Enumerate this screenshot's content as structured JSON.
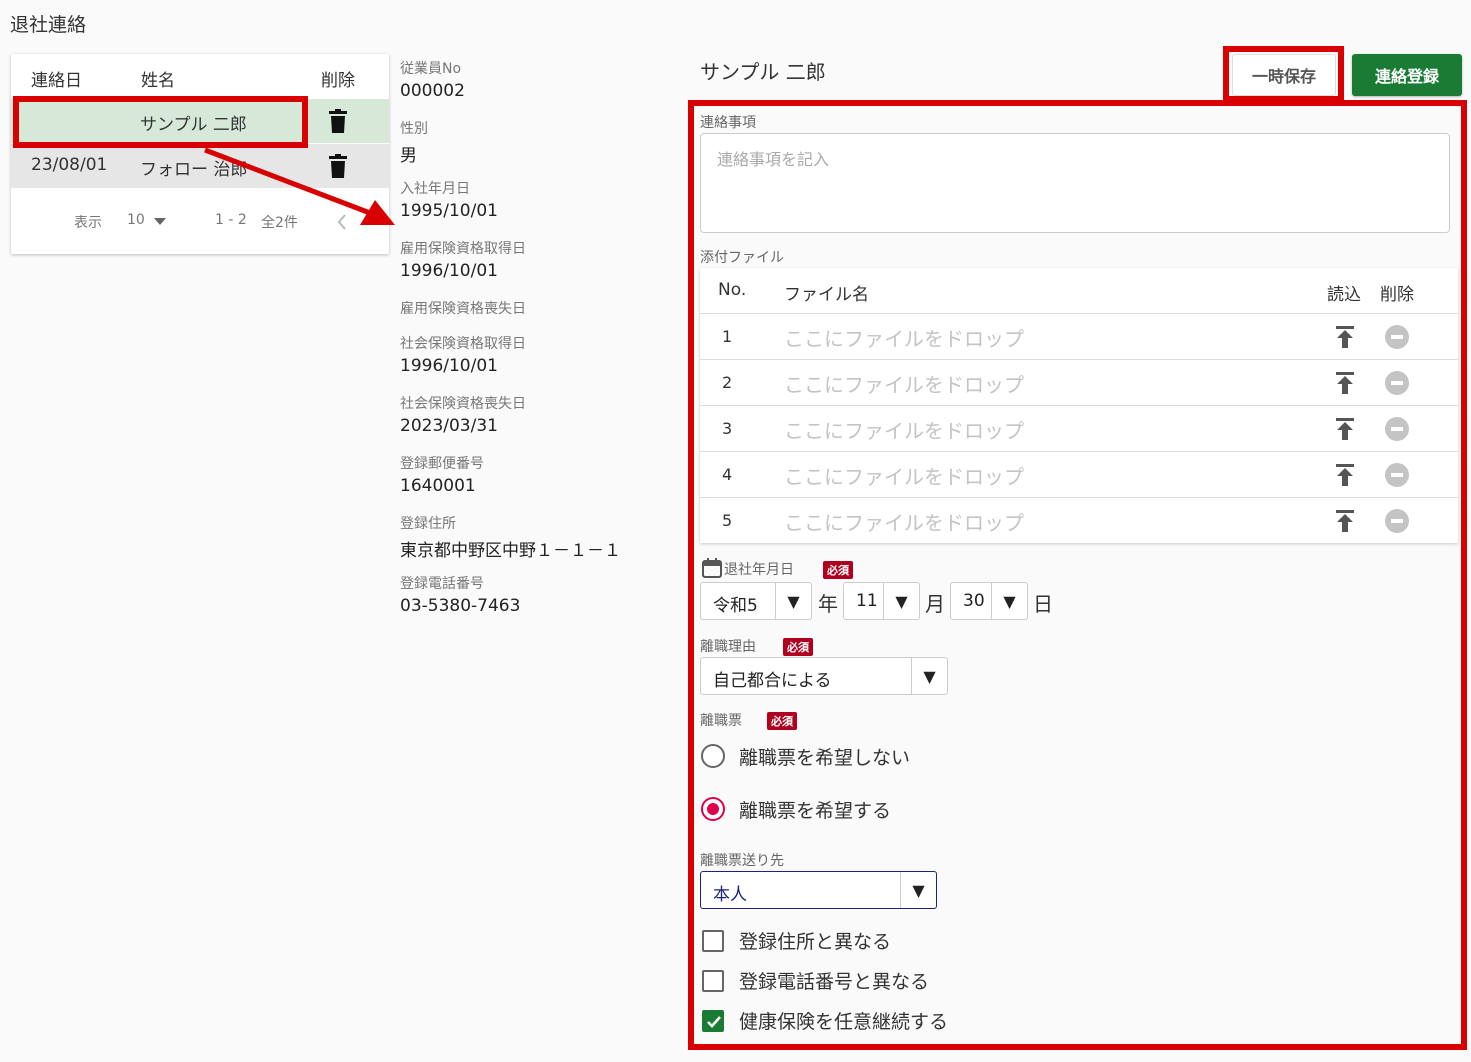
{
  "page": {
    "title": "退社連絡"
  },
  "list": {
    "headers": {
      "date": "連絡日",
      "name": "姓名",
      "delete": "削除"
    },
    "rows": [
      {
        "date": "",
        "name": "サンプル 二郎",
        "selected": true
      },
      {
        "date": "23/08/01",
        "name": "フォロー 治郎",
        "selected": false
      }
    ],
    "pager": {
      "display_label": "表示",
      "page_size": "10",
      "range": "1 - 2",
      "total": "全2件"
    }
  },
  "employee": {
    "fields": [
      {
        "label": "従業員No",
        "value": "000002"
      },
      {
        "label": "性別",
        "value": "男"
      },
      {
        "label": "入社年月日",
        "value": "1995/10/01"
      },
      {
        "label": "雇用保険資格取得日",
        "value": "1996/10/01"
      },
      {
        "label": "雇用保険資格喪失日",
        "value": ""
      },
      {
        "label": "社会保険資格取得日",
        "value": "1996/10/01"
      },
      {
        "label": "社会保険資格喪失日",
        "value": "2023/03/31"
      },
      {
        "label": "登録郵便番号",
        "value": "1640001"
      },
      {
        "label": "登録住所",
        "value": "東京都中野区中野１－１－１"
      },
      {
        "label": "登録電話番号",
        "value": "03-5380-7463"
      }
    ]
  },
  "detail": {
    "person_name": "サンプル 二郎",
    "temp_save_label": "一時保存",
    "register_label": "連絡登録",
    "notes_label": "連絡事項",
    "notes_placeholder": "連絡事項を記入",
    "attachments_label": "添付ファイル",
    "file_table": {
      "headers": {
        "no": "No.",
        "filename": "ファイル名",
        "load": "読込",
        "delete": "削除"
      },
      "rows": [
        {
          "no": "1",
          "placeholder": "ここにファイルをドロップ"
        },
        {
          "no": "2",
          "placeholder": "ここにファイルをドロップ"
        },
        {
          "no": "3",
          "placeholder": "ここにファイルをドロップ"
        },
        {
          "no": "4",
          "placeholder": "ここにファイルをドロップ"
        },
        {
          "no": "5",
          "placeholder": "ここにファイルをドロップ"
        }
      ]
    },
    "required_badge": "必須",
    "leave_date": {
      "label": "退社年月日",
      "era": "令和5",
      "year_unit": "年",
      "month": "11",
      "month_unit": "月",
      "day": "30",
      "day_unit": "日",
      "arrow": "▼"
    },
    "reason": {
      "label": "離職理由",
      "value": "自己都合による"
    },
    "separation_slip": {
      "label": "離職票",
      "options": [
        {
          "text": "離職票を希望しない",
          "selected": false
        },
        {
          "text": "離職票を希望する",
          "selected": true
        }
      ]
    },
    "send_to": {
      "label": "離職票送り先",
      "value": "本人"
    },
    "checks": [
      {
        "text": "登録住所と異なる",
        "checked": false
      },
      {
        "text": "登録電話番号と異なる",
        "checked": false
      },
      {
        "text": "健康保険を任意継続する",
        "checked": true
      }
    ]
  },
  "colors": {
    "primary_green": "#1a7b35",
    "highlight_red": "#d80000",
    "radio_accent": "#e0004a",
    "selected_row": "#d6e9d9"
  }
}
